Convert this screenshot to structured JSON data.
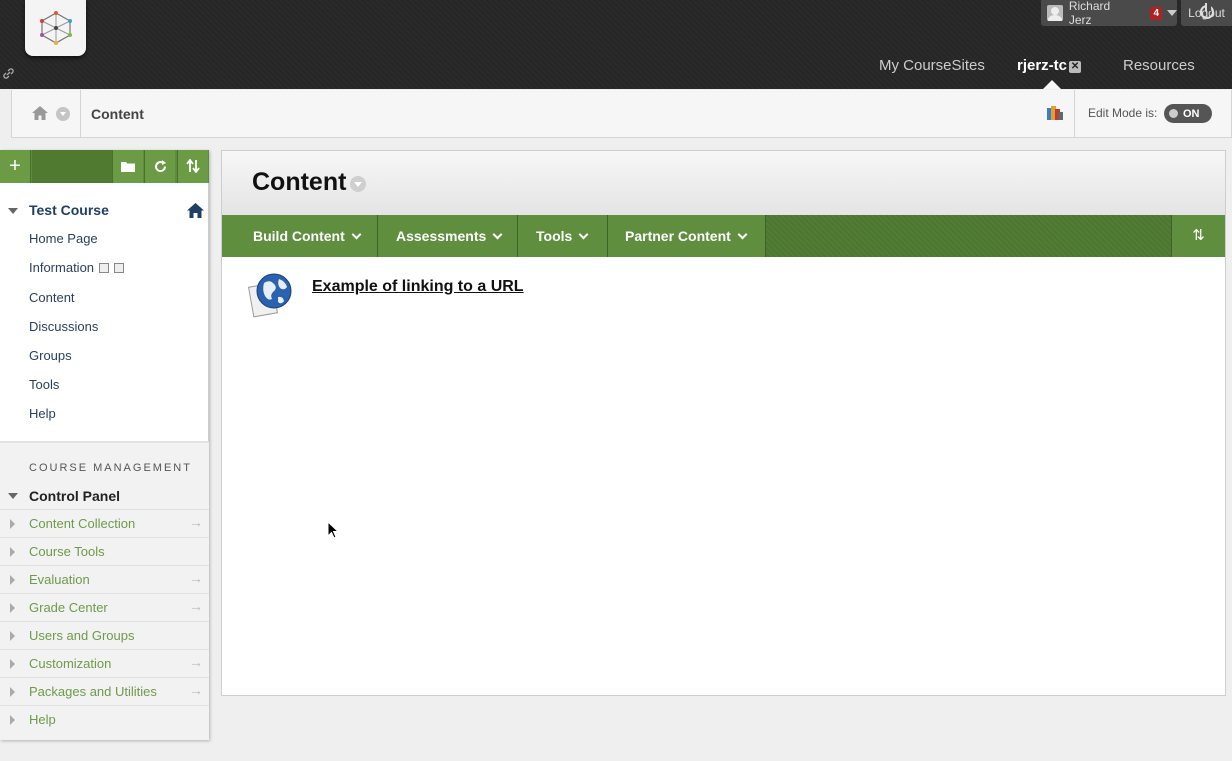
{
  "header": {
    "user_name": "Richard Jerz",
    "notification_count": "4",
    "logout_label": "Logout",
    "tabs": [
      {
        "label": "My CourseSites",
        "active": false
      },
      {
        "label": "rjerz-tc",
        "active": true
      },
      {
        "label": "Resources",
        "active": false
      }
    ],
    "close_glyph": "✕"
  },
  "breadcrumb": {
    "current": "Content",
    "edit_mode_label": "Edit Mode is:",
    "edit_mode_value": "ON"
  },
  "sidebar": {
    "add_glyph": "+",
    "course_title": "Test Course",
    "course_items": [
      "Home Page",
      "Information",
      "Content",
      "Discussions",
      "Groups",
      "Tools",
      "Help"
    ],
    "management_header": "COURSE MANAGEMENT",
    "control_panel_title": "Control Panel",
    "control_panel_items": [
      {
        "label": "Content Collection",
        "has_arrow": true
      },
      {
        "label": "Course Tools",
        "has_arrow": false
      },
      {
        "label": "Evaluation",
        "has_arrow": true
      },
      {
        "label": "Grade Center",
        "has_arrow": true
      },
      {
        "label": "Users and Groups",
        "has_arrow": false
      },
      {
        "label": "Customization",
        "has_arrow": true
      },
      {
        "label": "Packages and Utilities",
        "has_arrow": true
      },
      {
        "label": "Help",
        "has_arrow": false
      }
    ],
    "arrow_glyph": "→"
  },
  "content": {
    "title": "Content",
    "actions": [
      "Build Content",
      "Assessments",
      "Tools",
      "Partner Content"
    ],
    "sort_glyph": "⇅",
    "items": [
      {
        "title": "Example of linking to a URL",
        "icon": "web-link-icon"
      }
    ]
  },
  "colors": {
    "accent_green": "#5f8e3f",
    "header_dark": "#2a2a2a",
    "link_green": "#6e9a4a",
    "course_blue": "#1f3e63"
  }
}
